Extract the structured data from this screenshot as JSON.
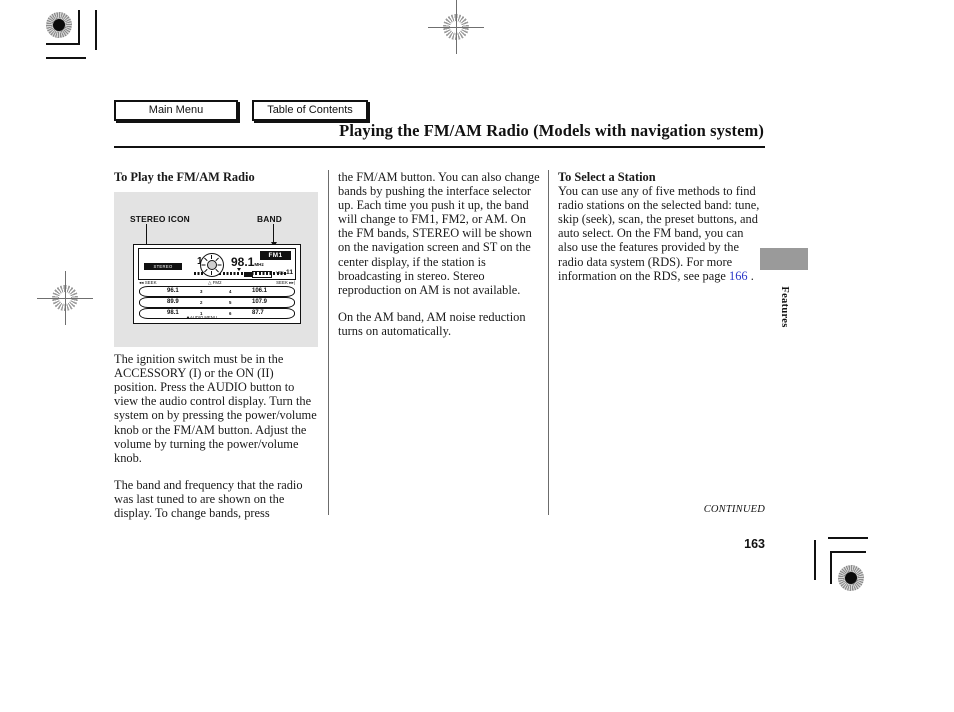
{
  "nav": {
    "main_menu_label": "Main Menu",
    "table_of_contents_label": "Table of Contents"
  },
  "header": {
    "title": "Playing the FM/AM Radio (Models with navigation system)"
  },
  "columns": {
    "left": {
      "heading": "To Play the FM/AM Radio",
      "paragraphs": [
        "The ignition switch must be in the ACCESSORY (I) or the ON (II) position. Press the AUDIO button to view the audio control display. Turn the system on by pressing the power/volume knob or the FM/AM button. Adjust the volume by turning the power/volume knob.",
        "The band and frequency that the radio was last tuned to are shown on the display. To change bands, press"
      ]
    },
    "middle": {
      "paragraphs": [
        "the FM/AM button. You can also change bands by pushing the interface selector up. Each time you push it up, the band will change to FM1, FM2, or AM. On the FM bands, STEREO will be shown on the navigation screen and ST on the center display, if the station is broadcasting in stereo. Stereo reproduction on AM is not available.",
        "On the AM band, AM noise reduction turns on automatically."
      ]
    },
    "right": {
      "heading": "To Select a Station",
      "text_before_link": "You can use any of five methods to find radio stations on the selected band: tune, skip (seek), scan, the preset buttons, and auto select. On the FM band, you can also use the features provided by the radio data system (RDS). For more information on the RDS, see page ",
      "link_label": "166",
      "text_after_link": " ."
    }
  },
  "illustration": {
    "callout_stereo": "STEREO ICON",
    "callout_band": "BAND",
    "display": {
      "stereo_badge": "STEREO",
      "channel_number": "1",
      "channel_unit": "CH",
      "frequency": "98.1",
      "frequency_unit": "MHz",
      "band_badge": "FM1",
      "volume_label": "VOL",
      "volume_value": "11",
      "seek_left": "SEEK",
      "seek_right": "SEEK",
      "tune_label": "FM2"
    },
    "presets": {
      "left_column": [
        "96.1",
        "89.9",
        "98.1"
      ],
      "left_numbers": [
        "3",
        "2",
        "1"
      ],
      "right_numbers": [
        "4",
        "5",
        "6"
      ],
      "right_column": [
        "106.1",
        "107.9",
        "87.7"
      ],
      "audio_menu_label": "AUDIO MENU"
    }
  },
  "side_tab": {
    "label": "Features"
  },
  "footer": {
    "continued": "CONTINUED",
    "page_number": "163"
  },
  "colors": {
    "link": "#2b38c8",
    "illustration_bg": "#e3e3e3",
    "tab_gray": "#9a9a9a",
    "ink": "#111111"
  }
}
